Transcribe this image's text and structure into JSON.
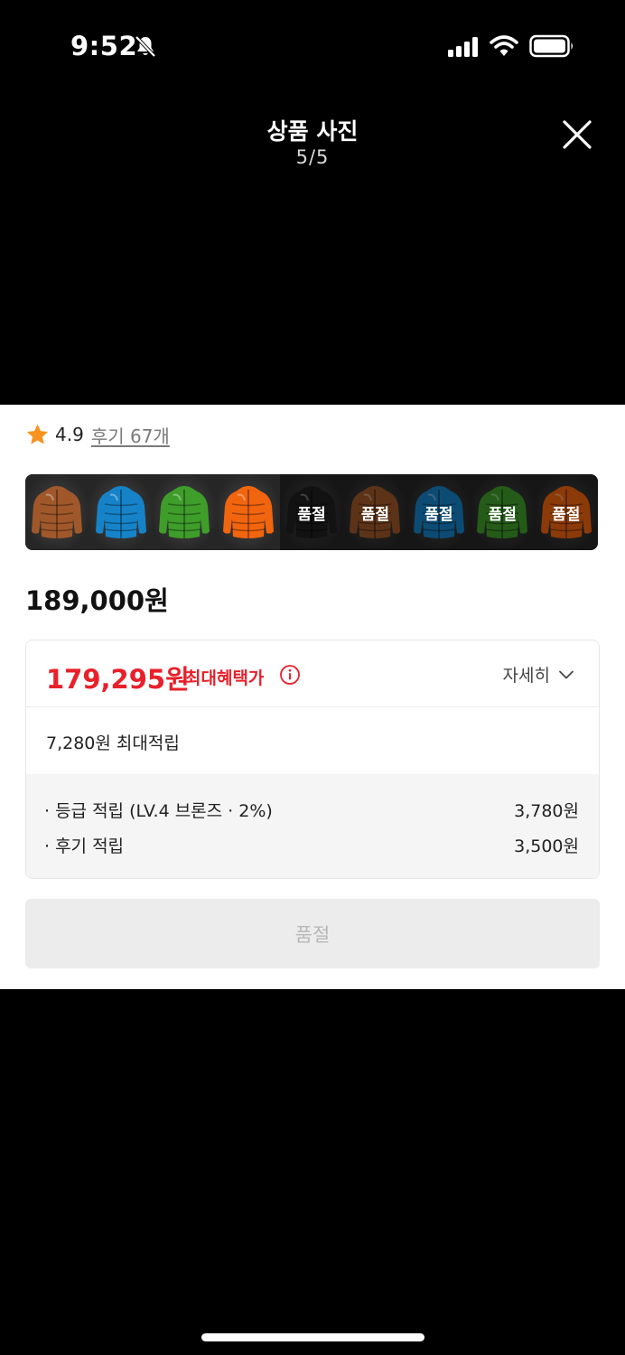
{
  "status_bar": {
    "time": "9:52",
    "icons": [
      "bell-slash-icon",
      "signal-icon",
      "wifi-icon",
      "battery-icon"
    ]
  },
  "header": {
    "title": "상품 사진",
    "counter": "5/5",
    "close_icon": "close-icon"
  },
  "rating": {
    "value": "4.9",
    "review_link": "후기 67개",
    "star_color": "#f7931e"
  },
  "thumbnails": [
    {
      "color": "#a0582a",
      "sold_out": false,
      "label": ""
    },
    {
      "color": "#1683c9",
      "sold_out": false,
      "label": ""
    },
    {
      "color": "#3f9d2a",
      "sold_out": false,
      "label": ""
    },
    {
      "color": "#f2650f",
      "sold_out": false,
      "label": ""
    },
    {
      "color": "#1f1f1f",
      "sold_out": true,
      "label": "품절"
    },
    {
      "color": "#a0582a",
      "sold_out": true,
      "label": "품절"
    },
    {
      "color": "#1683c9",
      "sold_out": true,
      "label": "품절"
    },
    {
      "color": "#3f9d2a",
      "sold_out": true,
      "label": "품절"
    },
    {
      "color": "#f2650f",
      "sold_out": true,
      "label": "품절"
    }
  ],
  "price": {
    "original": "189,000원"
  },
  "benefit": {
    "max_price": "179,295원",
    "max_price_label": "최대혜택가",
    "detail_label": "자세히",
    "points_total": "7,280원 최대적립",
    "points_rows": [
      {
        "label": "· 등급 적립 (LV.4 브론즈 · 2%)",
        "value": "3,780원"
      },
      {
        "label": "· 후기 적립",
        "value": "3,500원"
      }
    ],
    "accent_color": "#e8202a"
  },
  "purchase_button": {
    "label": "품절"
  }
}
